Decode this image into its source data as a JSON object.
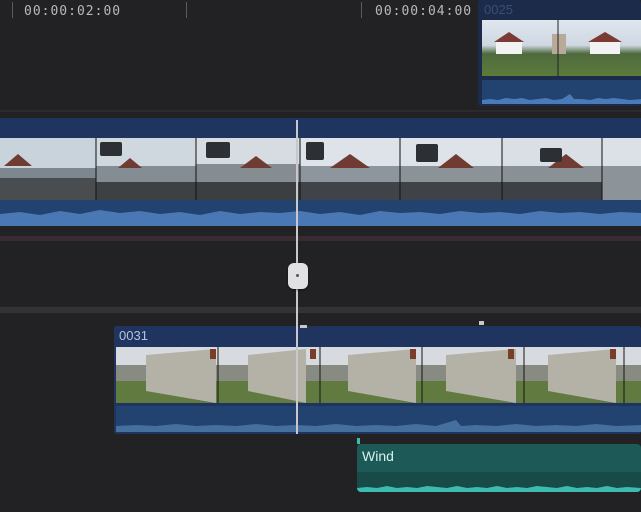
{
  "ruler": {
    "time_1": "00:00:02:00",
    "time_2": "00:00:04:00"
  },
  "clips": {
    "top_right_clip": {
      "name": "0025"
    },
    "lower_clip": {
      "name": "0031"
    },
    "audio_clip": {
      "name": "Wind"
    }
  },
  "colors": {
    "clip_header": "#1f3560",
    "audio_strip": "#254a82",
    "audio_clip_bg": "#1d5a57",
    "playhead": "#c8c8cc"
  }
}
